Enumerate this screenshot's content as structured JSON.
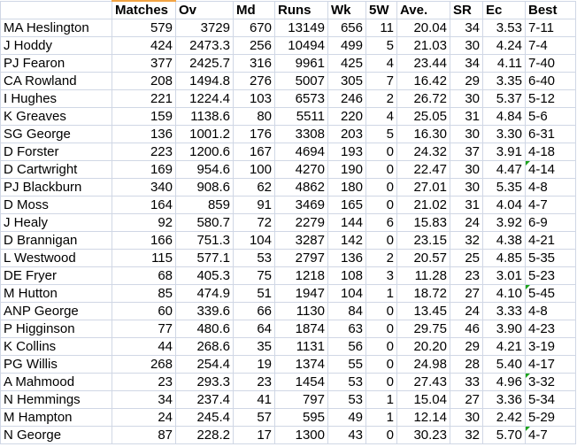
{
  "headers": [
    "",
    "Matches",
    "Ov",
    "Md",
    "Runs",
    "Wk",
    "5W",
    "Ave.",
    "SR",
    "Ec",
    "Best"
  ],
  "rows": [
    [
      "MA Heslington",
      "579",
      "3729",
      "670",
      "13149",
      "656",
      "11",
      "20.04",
      "34",
      "3.53",
      "7-11"
    ],
    [
      "J Hoddy",
      "424",
      "2473.3",
      "256",
      "10494",
      "499",
      "5",
      "21.03",
      "30",
      "4.24",
      "7-4"
    ],
    [
      "PJ Fearon",
      "377",
      "2425.7",
      "316",
      "9961",
      "425",
      "4",
      "23.44",
      "34",
      "4.11",
      "7-40"
    ],
    [
      "CA Rowland",
      "208",
      "1494.8",
      "276",
      "5007",
      "305",
      "7",
      "16.42",
      "29",
      "3.35",
      "6-40"
    ],
    [
      "I Hughes",
      "221",
      "1224.4",
      "103",
      "6573",
      "246",
      "2",
      "26.72",
      "30",
      "5.37",
      "5-12"
    ],
    [
      "K Greaves",
      "159",
      "1138.6",
      "80",
      "5511",
      "220",
      "4",
      "25.05",
      "31",
      "4.84",
      "5-6"
    ],
    [
      "SG George",
      "136",
      "1001.2",
      "176",
      "3308",
      "203",
      "5",
      "16.30",
      "30",
      "3.30",
      "6-31"
    ],
    [
      "D Forster",
      "223",
      "1200.6",
      "167",
      "4694",
      "193",
      "0",
      "24.32",
      "37",
      "3.91",
      "4-18"
    ],
    [
      "D Cartwright",
      "169",
      "954.6",
      "100",
      "4270",
      "190",
      "0",
      "22.47",
      "30",
      "4.47",
      "4-14"
    ],
    [
      "PJ Blackburn",
      "340",
      "908.6",
      "62",
      "4862",
      "180",
      "0",
      "27.01",
      "30",
      "5.35",
      "4-8"
    ],
    [
      "D Moss",
      "164",
      "859",
      "91",
      "3469",
      "165",
      "0",
      "21.02",
      "31",
      "4.04",
      "4-7"
    ],
    [
      "J Healy",
      "92",
      "580.7",
      "72",
      "2279",
      "144",
      "6",
      "15.83",
      "24",
      "3.92",
      "6-9"
    ],
    [
      "D Brannigan",
      "166",
      "751.3",
      "104",
      "3287",
      "142",
      "0",
      "23.15",
      "32",
      "4.38",
      "4-21"
    ],
    [
      "L Westwood",
      "115",
      "577.1",
      "53",
      "2797",
      "136",
      "2",
      "20.57",
      "25",
      "4.85",
      "5-35"
    ],
    [
      "DE Fryer",
      "68",
      "405.3",
      "75",
      "1218",
      "108",
      "3",
      "11.28",
      "23",
      "3.01",
      "5-23"
    ],
    [
      "M Hutton",
      "85",
      "474.9",
      "51",
      "1947",
      "104",
      "1",
      "18.72",
      "27",
      "4.10",
      "5-45"
    ],
    [
      "ANP George",
      "60",
      "339.6",
      "66",
      "1130",
      "84",
      "0",
      "13.45",
      "24",
      "3.33",
      "4-8"
    ],
    [
      "P Higginson",
      "77",
      "480.6",
      "64",
      "1874",
      "63",
      "0",
      "29.75",
      "46",
      "3.90",
      "4-23"
    ],
    [
      "K Collins",
      "44",
      "268.6",
      "35",
      "1131",
      "56",
      "0",
      "20.20",
      "29",
      "4.21",
      "3-19"
    ],
    [
      "PG Willis",
      "268",
      "254.4",
      "19",
      "1374",
      "55",
      "0",
      "24.98",
      "28",
      "5.40",
      "4-17"
    ],
    [
      "A Mahmood",
      "23",
      "293.3",
      "23",
      "1454",
      "53",
      "0",
      "27.43",
      "33",
      "4.96",
      "3-32"
    ],
    [
      "N Hemmings",
      "34",
      "237.4",
      "41",
      "797",
      "53",
      "1",
      "15.04",
      "27",
      "3.36",
      "5-34"
    ],
    [
      "M Hampton",
      "24",
      "245.4",
      "57",
      "595",
      "49",
      "1",
      "12.14",
      "30",
      "2.42",
      "5-29"
    ],
    [
      "N George",
      "87",
      "228.2",
      "17",
      "1300",
      "43",
      "0",
      "30.23",
      "32",
      "5.70",
      "4-7"
    ]
  ],
  "error_indicator_rows": [
    8,
    15,
    20,
    23
  ],
  "colors": {
    "gridline": "#d0d7e5",
    "error_indicator": "#1ca31c",
    "selection": "#f2a444"
  }
}
